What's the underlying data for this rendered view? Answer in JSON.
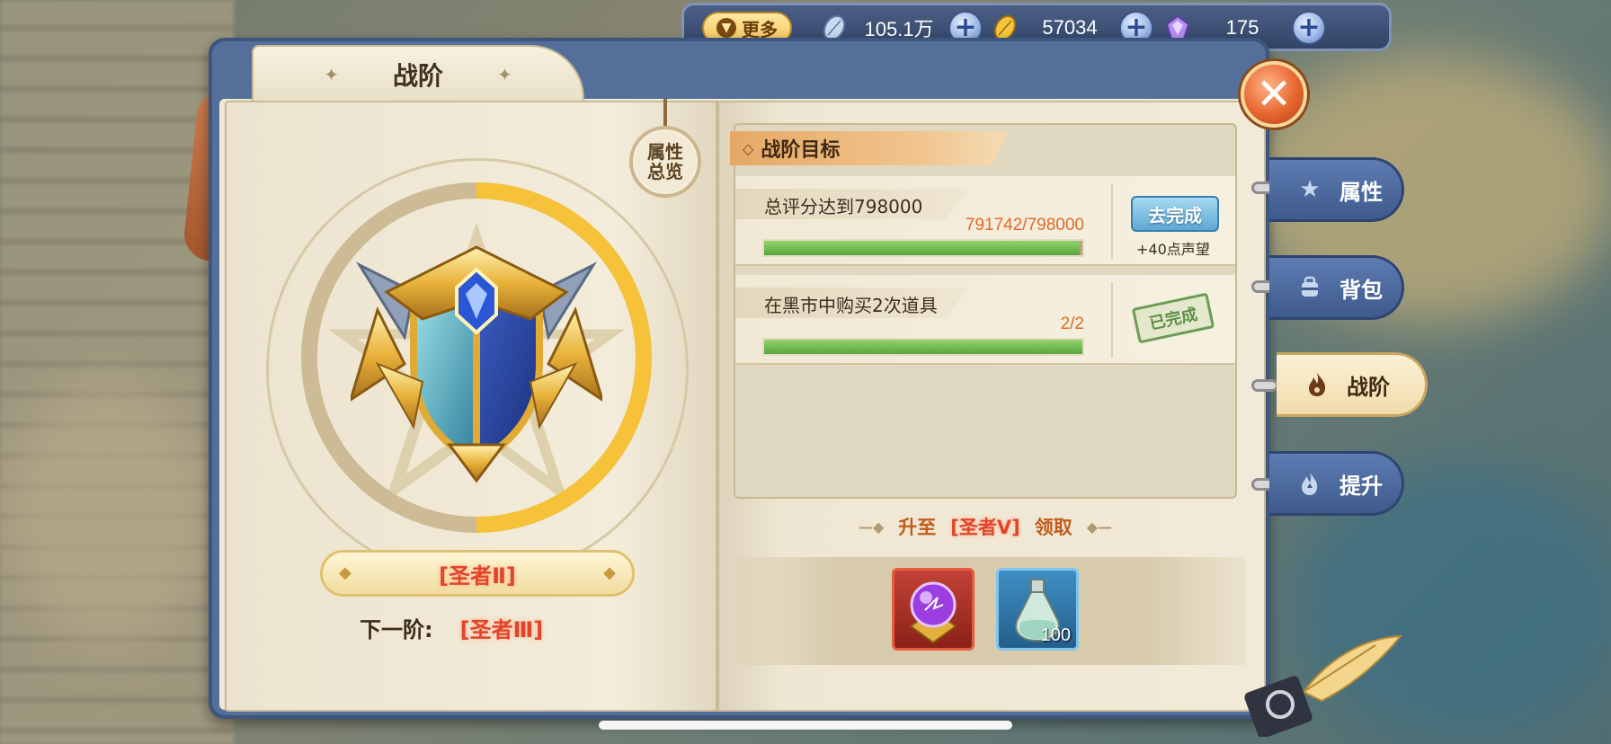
{
  "topbar": {
    "more_label": "更多",
    "currencies": [
      {
        "icon": "silver-leaf-icon",
        "value": "105.1万"
      },
      {
        "icon": "gold-leaf-icon",
        "value": "57034"
      },
      {
        "icon": "gem-icon",
        "value": "175"
      }
    ]
  },
  "panel": {
    "title": "战阶",
    "attr_overview_line1": "属性",
    "attr_overview_line2": "总览",
    "current_rank": "[圣者Ⅱ]",
    "next_label": "下一阶:",
    "next_rank": "[圣者Ⅲ]",
    "rank_progress": 0.5
  },
  "goals": {
    "header": "战阶目标",
    "items": [
      {
        "title": "总评分达到798000",
        "progress_text": "791742/798000",
        "progress": 0.9922,
        "action_label": "去完成",
        "reward_text": "+40点声望",
        "done": false
      },
      {
        "title": "在黑市中购买2次道具",
        "progress_text": "2/2",
        "progress": 1.0,
        "done_label": "已完成",
        "done": true
      }
    ]
  },
  "upgrade": {
    "prefix": "升至",
    "rank": "[圣者Ⅴ]",
    "suffix": "领取"
  },
  "rewards": [
    {
      "icon": "purple-orb-icon",
      "qty": ""
    },
    {
      "icon": "potion-flask-icon",
      "qty": "100"
    }
  ],
  "side_tabs": [
    {
      "label": "属性",
      "icon": "star-icon",
      "active": false
    },
    {
      "label": "背包",
      "icon": "backpack-icon",
      "active": false
    },
    {
      "label": "战阶",
      "icon": "flame-icon",
      "active": true
    },
    {
      "label": "提升",
      "icon": "upgrade-flame-icon",
      "active": false
    }
  ],
  "colors": {
    "accent_red": "#e0452c",
    "progress_green": "#5aa63e",
    "frame_blue": "#556f9b",
    "progress_gold": "#f5c23a"
  }
}
